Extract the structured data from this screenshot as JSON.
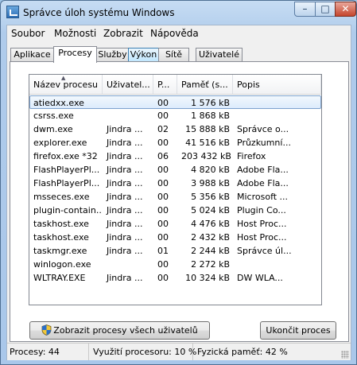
{
  "window": {
    "title": "Správce úloh systému Windows"
  },
  "titlebar": {
    "min_glyph": "–",
    "max_glyph": "□",
    "close_glyph": "✕"
  },
  "menu": [
    "Soubor",
    "Možnosti",
    "Zobrazit",
    "Nápověda"
  ],
  "tabs": [
    "Aplikace",
    "Procesy",
    "Služby",
    "Výkon",
    "Sítě",
    "Uživatelé"
  ],
  "active_tab": "Procesy",
  "columns": [
    "Název procesu",
    "Uživatel...",
    "P...",
    "Paměť (s...",
    "Popis"
  ],
  "processes": [
    {
      "name": "atiedxx.exe",
      "user": "",
      "cpu": "00",
      "mem": "1 576 kB",
      "desc": "",
      "selected": true
    },
    {
      "name": "csrss.exe",
      "user": "",
      "cpu": "00",
      "mem": "1 868 kB",
      "desc": ""
    },
    {
      "name": "dwm.exe",
      "user": "Jindra ...",
      "cpu": "02",
      "mem": "15 888 kB",
      "desc": "Správce o..."
    },
    {
      "name": "explorer.exe",
      "user": "Jindra ...",
      "cpu": "00",
      "mem": "41 516 kB",
      "desc": "Průzkumní..."
    },
    {
      "name": "firefox.exe *32",
      "user": "Jindra ...",
      "cpu": "06",
      "mem": "203 432 kB",
      "desc": "Firefox"
    },
    {
      "name": "FlashPlayerPl...",
      "user": "Jindra ...",
      "cpu": "00",
      "mem": "4 820 kB",
      "desc": "Adobe Fla..."
    },
    {
      "name": "FlashPlayerPl...",
      "user": "Jindra ...",
      "cpu": "00",
      "mem": "3 988 kB",
      "desc": "Adobe Fla..."
    },
    {
      "name": "msseces.exe",
      "user": "Jindra ...",
      "cpu": "00",
      "mem": "5 356 kB",
      "desc": "Microsoft ..."
    },
    {
      "name": "plugin-contain...",
      "user": "Jindra ...",
      "cpu": "00",
      "mem": "5 024 kB",
      "desc": "Plugin Co..."
    },
    {
      "name": "taskhost.exe",
      "user": "Jindra ...",
      "cpu": "00",
      "mem": "4 476 kB",
      "desc": "Host Proc..."
    },
    {
      "name": "taskhost.exe",
      "user": "Jindra ...",
      "cpu": "00",
      "mem": "2 432 kB",
      "desc": "Host Proc..."
    },
    {
      "name": "taskmgr.exe",
      "user": "Jindra ...",
      "cpu": "01",
      "mem": "2 244 kB",
      "desc": "Správce úl..."
    },
    {
      "name": "winlogon.exe",
      "user": "",
      "cpu": "00",
      "mem": "2 272 kB",
      "desc": ""
    },
    {
      "name": "WLTRAY.EXE",
      "user": "Jindra ...",
      "cpu": "00",
      "mem": "10 324 kB",
      "desc": "DW WLA..."
    }
  ],
  "buttons": {
    "show_all": "Zobrazit procesy všech uživatelů",
    "end_process": "Ukončit proces"
  },
  "icons": {
    "app": "task-manager-icon",
    "uac": "uac-shield-icon",
    "sort": "sort-ascending-icon"
  },
  "status": {
    "processes": "Procesy: 44",
    "cpu": "Využití procesoru: 10 %",
    "memory": "Fyzická paměť: 42 %"
  },
  "colors": {
    "selection": "#dcebfc",
    "title_bar": "#b8d2ee",
    "close_button": "#c5452d"
  }
}
